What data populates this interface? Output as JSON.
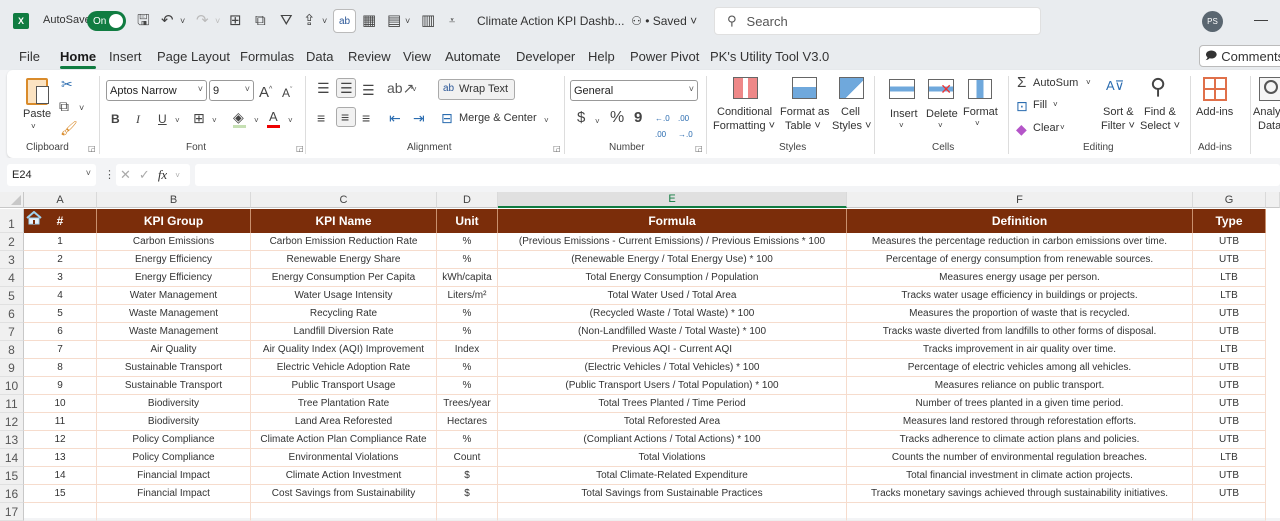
{
  "titlebar": {
    "app_logo": "X",
    "autosave_label": "AutoSave",
    "autosave_state": "On",
    "document_title": "Climate Action KPI Dashb...",
    "save_status": "• Saved",
    "search_placeholder": "Search",
    "user_initials": "PS",
    "minimize": "—"
  },
  "menu": {
    "tabs": [
      "File",
      "Home",
      "Insert",
      "Page Layout",
      "Formulas",
      "Data",
      "Review",
      "View",
      "Automate",
      "Developer",
      "Help",
      "Power Pivot",
      "PK's Utility Tool V3.0"
    ],
    "active_tab": "Home",
    "comments_label": "Comments"
  },
  "ribbon": {
    "clipboard": {
      "paste": "Paste",
      "label": "Clipboard"
    },
    "font": {
      "font_name": "Aptos Narrow",
      "font_size": "9",
      "bold": "B",
      "italic": "I",
      "underline": "U",
      "label": "Font",
      "grow": "A",
      "shrink": "A"
    },
    "alignment": {
      "wrap_text": "Wrap Text",
      "merge_center": "Merge & Center",
      "label": "Alignment"
    },
    "number": {
      "format": "General",
      "currency": "$",
      "percent": "%",
      "comma": "9",
      "inc_decimal": "←.0 .00",
      "dec_decimal": ".00 →.0",
      "label": "Number"
    },
    "styles": {
      "conditional_formatting": [
        "Conditional",
        "Formatting ˅"
      ],
      "format_as_table": [
        "Format as",
        "Table ˅"
      ],
      "cell_styles": [
        "Cell",
        "Styles ˅"
      ],
      "label": "Styles"
    },
    "cells": {
      "insert": "Insert",
      "delete": "Delete",
      "format": "Format",
      "label": "Cells"
    },
    "editing": {
      "autosum": "AutoSum",
      "fill": "Fill",
      "clear": "Clear",
      "sort_filter": [
        "Sort &",
        "Filter ˅"
      ],
      "find_select": [
        "Find &",
        "Select ˅"
      ],
      "label": "Editing"
    },
    "addins": {
      "addins": "Add-ins",
      "label": "Add-ins"
    },
    "analyze": {
      "label": [
        "Analyze",
        "Data"
      ]
    }
  },
  "formula_bar": {
    "name_box": "E24",
    "fx": "fx",
    "formula": ""
  },
  "sheet": {
    "columns": [
      "A",
      "B",
      "C",
      "D",
      "E",
      "F",
      "G"
    ],
    "selected_column": "E",
    "row_numbers": [
      "1",
      "2",
      "3",
      "4",
      "5",
      "6",
      "7",
      "8",
      "9",
      "10",
      "11",
      "12",
      "13",
      "14",
      "15",
      "16",
      "17"
    ],
    "header_color": "#7b2d0a",
    "headers": [
      "#",
      "KPI Group",
      "KPI Name",
      "Unit",
      "Formula",
      "Definition",
      "Type"
    ],
    "rows": [
      [
        "1",
        "Carbon Emissions",
        "Carbon Emission Reduction Rate",
        "%",
        "(Previous Emissions - Current Emissions) / Previous Emissions * 100",
        "Measures the percentage reduction in carbon emissions over time.",
        "UTB"
      ],
      [
        "2",
        "Energy Efficiency",
        "Renewable Energy Share",
        "%",
        "(Renewable Energy / Total Energy Use) * 100",
        "Percentage of energy consumption from renewable sources.",
        "UTB"
      ],
      [
        "3",
        "Energy Efficiency",
        "Energy Consumption Per Capita",
        "kWh/capita",
        "Total Energy Consumption / Population",
        "Measures energy usage per person.",
        "LTB"
      ],
      [
        "4",
        "Water Management",
        "Water Usage Intensity",
        "Liters/m²",
        "Total Water Used / Total Area",
        "Tracks water usage efficiency in buildings or projects.",
        "LTB"
      ],
      [
        "5",
        "Waste Management",
        "Recycling Rate",
        "%",
        "(Recycled Waste / Total Waste) * 100",
        "Measures the proportion of waste that is recycled.",
        "UTB"
      ],
      [
        "6",
        "Waste Management",
        "Landfill Diversion Rate",
        "%",
        "(Non-Landfilled Waste / Total Waste) * 100",
        "Tracks waste diverted from landfills to other forms of disposal.",
        "UTB"
      ],
      [
        "7",
        "Air Quality",
        "Air Quality Index (AQI) Improvement",
        "Index",
        "Previous AQI - Current AQI",
        "Tracks improvement in air quality over time.",
        "LTB"
      ],
      [
        "8",
        "Sustainable Transport",
        "Electric Vehicle Adoption Rate",
        "%",
        "(Electric Vehicles / Total Vehicles) * 100",
        "Percentage of electric vehicles among all vehicles.",
        "UTB"
      ],
      [
        "9",
        "Sustainable Transport",
        "Public Transport Usage",
        "%",
        "(Public Transport Users / Total Population) * 100",
        "Measures reliance on public transport.",
        "UTB"
      ],
      [
        "10",
        "Biodiversity",
        "Tree Plantation Rate",
        "Trees/year",
        "Total Trees Planted / Time Period",
        "Number of trees planted in a given time period.",
        "UTB"
      ],
      [
        "11",
        "Biodiversity",
        "Land Area Reforested",
        "Hectares",
        "Total Reforested Area",
        "Measures land restored through reforestation efforts.",
        "UTB"
      ],
      [
        "12",
        "Policy Compliance",
        "Climate Action Plan Compliance Rate",
        "%",
        "(Compliant Actions / Total Actions) * 100",
        "Tracks adherence to climate action plans and policies.",
        "UTB"
      ],
      [
        "13",
        "Policy Compliance",
        "Environmental Violations",
        "Count",
        "Total Violations",
        "Counts the number of environmental regulation breaches.",
        "LTB"
      ],
      [
        "14",
        "Financial Impact",
        "Climate Action Investment",
        "$",
        "Total Climate-Related Expenditure",
        "Total financial investment in climate action projects.",
        "UTB"
      ],
      [
        "15",
        "Financial Impact",
        "Cost Savings from Sustainability",
        "$",
        "Total Savings from Sustainable Practices",
        "Tracks monetary savings achieved through sustainability initiatives.",
        "UTB"
      ]
    ]
  }
}
